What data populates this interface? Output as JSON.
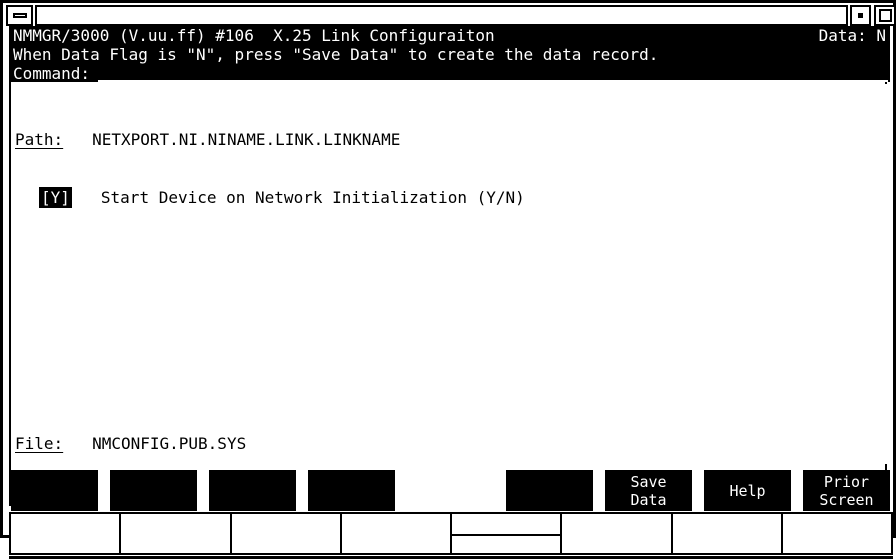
{
  "window": {
    "title": "",
    "buttons": {
      "minimize_left": "minimize",
      "restore": "restore",
      "maximize": "maximize"
    }
  },
  "header": {
    "title_line": "NMMGR/3000 (V.uu.ff) #106  X.25 Link Configuraiton",
    "data_flag_label": "Data: N",
    "hint_line": "When Data Flag is \"N\", press \"Save Data\" to create the data record.",
    "command_label": "Command:",
    "command_value": ""
  },
  "form": {
    "path_label": "Path:",
    "path_value": "NETXPORT.NI.NINAME.LINK.LINKNAME",
    "field_value": "[Y]",
    "field_label": "Start Device on Network Initialization (Y/N)",
    "file_label": "File:",
    "file_value": "NMCONFIG.PUB.SYS"
  },
  "function_keys": [
    {
      "id": "f1",
      "line1": "",
      "line2": ""
    },
    {
      "id": "f2",
      "line1": "",
      "line2": ""
    },
    {
      "id": "f3",
      "line1": "",
      "line2": ""
    },
    {
      "id": "f4",
      "line1": "",
      "line2": ""
    },
    {
      "id": "f5",
      "line1": "",
      "line2": ""
    },
    {
      "id": "f6",
      "line1": "Save",
      "line2": "Data"
    },
    {
      "id": "f7",
      "line1": "Help",
      "line2": ""
    },
    {
      "id": "f8",
      "line1": "Prior",
      "line2": "Screen"
    }
  ],
  "key_row": [
    {
      "id": "k1",
      "label": ""
    },
    {
      "id": "k2",
      "label": ""
    },
    {
      "id": "k3",
      "label": ""
    },
    {
      "id": "k4",
      "label": ""
    },
    {
      "id": "k5",
      "label": "",
      "split": true
    },
    {
      "id": "k6",
      "label": ""
    },
    {
      "id": "k7",
      "label": ""
    },
    {
      "id": "k8",
      "label": ""
    }
  ],
  "colors": {
    "background": "#ffffff",
    "foreground": "#000000",
    "reverse_bg": "#000000",
    "reverse_fg": "#ffffff"
  }
}
